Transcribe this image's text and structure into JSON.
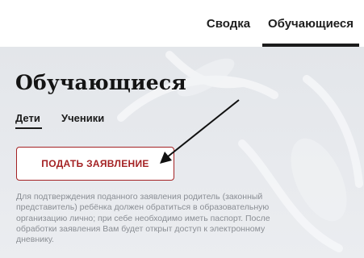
{
  "header": {
    "tabs": [
      {
        "label": "Сводка",
        "active": false
      },
      {
        "label": "Обучающиеся",
        "active": true
      }
    ]
  },
  "main": {
    "title": "Обучающиеся",
    "subtabs": [
      {
        "label": "Дети",
        "active": true
      },
      {
        "label": "Ученики",
        "active": false
      }
    ],
    "apply_button_label": "ПОДАТЬ ЗАЯВЛЕНИЕ",
    "info_text": "Для подтверждения поданного заявления родитель (законный представитель) ребёнка должен обратиться в образовательную организацию лично; при себе необходимо иметь паспорт. После обработки заявления Вам будет открыт доступ к электронному дневнику."
  },
  "colors": {
    "accent": "#a42224",
    "background": "#e6e8ec",
    "annotation_arrow": "#111111"
  }
}
